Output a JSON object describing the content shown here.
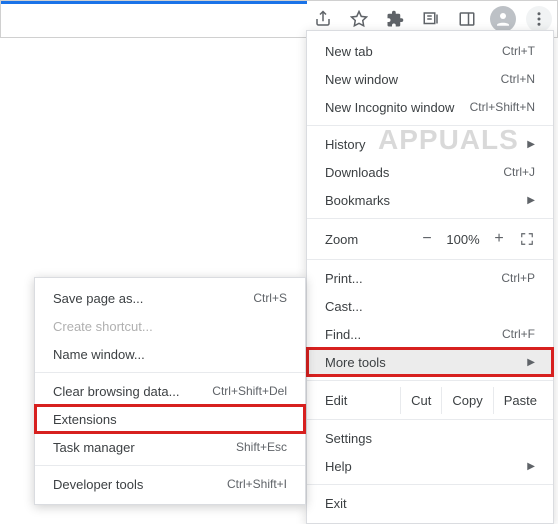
{
  "menu": {
    "newTab": {
      "label": "New tab",
      "accel": "Ctrl+T"
    },
    "newWindow": {
      "label": "New window",
      "accel": "Ctrl+N"
    },
    "newIncognito": {
      "label": "New Incognito window",
      "accel": "Ctrl+Shift+N"
    },
    "history": {
      "label": "History"
    },
    "downloads": {
      "label": "Downloads",
      "accel": "Ctrl+J"
    },
    "bookmarks": {
      "label": "Bookmarks"
    },
    "zoom": {
      "label": "Zoom",
      "minus": "−",
      "value": "100%",
      "plus": "+"
    },
    "print": {
      "label": "Print...",
      "accel": "Ctrl+P"
    },
    "cast": {
      "label": "Cast..."
    },
    "find": {
      "label": "Find...",
      "accel": "Ctrl+F"
    },
    "moreTools": {
      "label": "More tools"
    },
    "edit": {
      "label": "Edit",
      "cut": "Cut",
      "copy": "Copy",
      "paste": "Paste"
    },
    "settings": {
      "label": "Settings"
    },
    "help": {
      "label": "Help"
    },
    "exit": {
      "label": "Exit"
    }
  },
  "submenu": {
    "savePage": {
      "label": "Save page as...",
      "accel": "Ctrl+S"
    },
    "createShortcut": {
      "label": "Create shortcut..."
    },
    "nameWindow": {
      "label": "Name window..."
    },
    "clearData": {
      "label": "Clear browsing data...",
      "accel": "Ctrl+Shift+Del"
    },
    "extensions": {
      "label": "Extensions"
    },
    "taskManager": {
      "label": "Task manager",
      "accel": "Shift+Esc"
    },
    "devTools": {
      "label": "Developer tools",
      "accel": "Ctrl+Shift+I"
    }
  },
  "watermark": "APPUALS"
}
